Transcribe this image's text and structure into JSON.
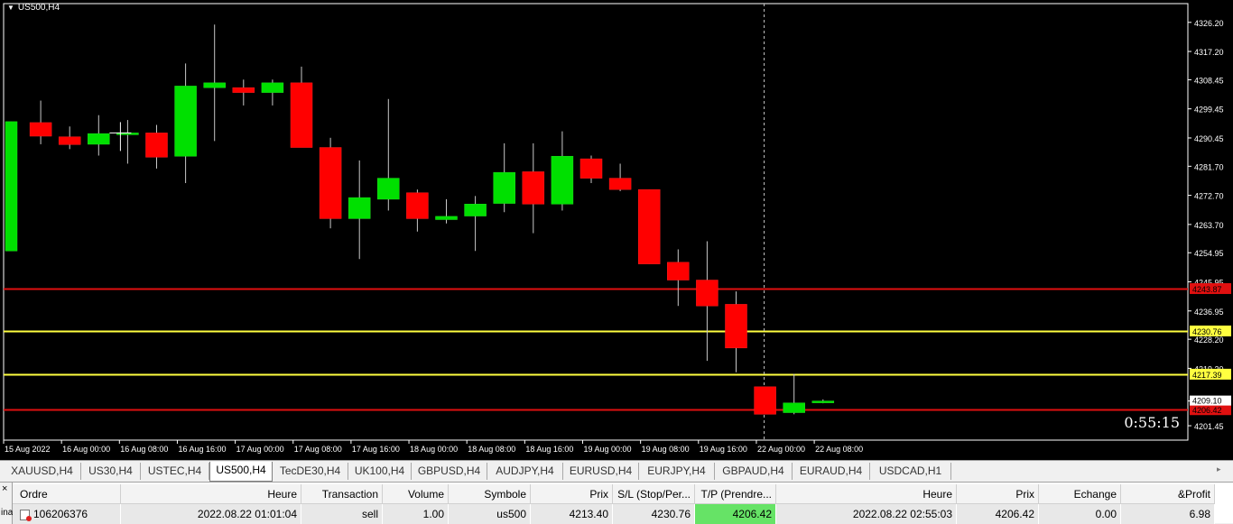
{
  "chart": {
    "symbol": "US500,H4",
    "countdown": "0:55:15",
    "colors": {
      "bull": "#00e000",
      "bear": "#ff0000",
      "wick": "#c8c8c8",
      "bg": "#000000",
      "axis": "#ffffff",
      "red_line": "#e01010",
      "yellow_line": "#ffff40"
    },
    "y_range": [
      4197.0,
      4332.0
    ],
    "price_ticks": [
      "4326.20",
      "4317.20",
      "4308.45",
      "4299.45",
      "4290.45",
      "4281.70",
      "4272.70",
      "4263.70",
      "4254.95",
      "4245.95",
      "4236.95",
      "4228.20",
      "4219.20",
      "4209.10",
      "4201.45"
    ],
    "time_labels": [
      "15 Aug 2022",
      "16 Aug 00:00",
      "16 Aug 08:00",
      "16 Aug 16:00",
      "17 Aug 00:00",
      "17 Aug 08:00",
      "17 Aug 16:00",
      "18 Aug 00:00",
      "18 Aug 08:00",
      "18 Aug 16:00",
      "19 Aug 00:00",
      "19 Aug 08:00",
      "19 Aug 16:00",
      "22 Aug 00:00",
      "22 Aug 08:00"
    ],
    "levels": [
      {
        "name": "level-red-upper",
        "price": 4243.87,
        "label": "4243.87",
        "kind": "red"
      },
      {
        "name": "level-sl",
        "price": 4230.76,
        "label": "4230.76",
        "kind": "yellow"
      },
      {
        "name": "level-yellow-lower",
        "price": 4217.39,
        "label": "4217.39",
        "kind": "yellow"
      },
      {
        "name": "level-tp",
        "price": 4206.42,
        "label": "4206.42",
        "kind": "red"
      }
    ],
    "current_price": "4209.10",
    "crosshair_index": 26
  },
  "chart_data": {
    "type": "candlestick",
    "title": "US500,H4",
    "candles": [
      {
        "o": 4255.5,
        "h": 4295.5,
        "l": 4255.5,
        "c": 4295.5
      },
      {
        "o": 4295.2,
        "h": 4302.0,
        "l": 4288.5,
        "c": 4291.0
      },
      {
        "o": 4290.8,
        "h": 4294.0,
        "l": 4287.0,
        "c": 4288.4
      },
      {
        "o": 4288.5,
        "h": 4297.5,
        "l": 4285.0,
        "c": 4291.8
      },
      {
        "o": 4292.0,
        "h": 4296.0,
        "l": 4282.5,
        "c": 4292.0
      },
      {
        "o": 4292.0,
        "h": 4294.5,
        "l": 4281.0,
        "c": 4284.5
      },
      {
        "o": 4284.8,
        "h": 4313.5,
        "l": 4276.5,
        "c": 4306.5
      },
      {
        "o": 4306.0,
        "h": 4325.5,
        "l": 4289.5,
        "c": 4307.5
      },
      {
        "o": 4306.0,
        "h": 4308.5,
        "l": 4300.5,
        "c": 4304.5
      },
      {
        "o": 4304.5,
        "h": 4308.5,
        "l": 4300.5,
        "c": 4307.5
      },
      {
        "o": 4307.5,
        "h": 4312.5,
        "l": 4287.5,
        "c": 4287.5
      },
      {
        "o": 4287.5,
        "h": 4290.5,
        "l": 4262.5,
        "c": 4265.5
      },
      {
        "o": 4265.5,
        "h": 4283.5,
        "l": 4253.0,
        "c": 4272.0
      },
      {
        "o": 4271.5,
        "h": 4302.5,
        "l": 4268.0,
        "c": 4278.0
      },
      {
        "o": 4273.5,
        "h": 4274.5,
        "l": 4261.5,
        "c": 4265.5
      },
      {
        "o": 4265.2,
        "h": 4271.5,
        "l": 4264.0,
        "c": 4266.2
      },
      {
        "o": 4266.3,
        "h": 4272.5,
        "l": 4255.5,
        "c": 4270.0
      },
      {
        "o": 4270.2,
        "h": 4288.8,
        "l": 4267.5,
        "c": 4279.8
      },
      {
        "o": 4280.0,
        "h": 4288.8,
        "l": 4261.0,
        "c": 4270.0
      },
      {
        "o": 4270.0,
        "h": 4292.5,
        "l": 4268.0,
        "c": 4284.8
      },
      {
        "o": 4284.0,
        "h": 4285.0,
        "l": 4276.5,
        "c": 4278.0
      },
      {
        "o": 4278.0,
        "h": 4282.5,
        "l": 4274.0,
        "c": 4274.5
      },
      {
        "o": 4274.5,
        "h": 4274.5,
        "l": 4251.5,
        "c": 4251.5
      },
      {
        "o": 4252.0,
        "h": 4256.0,
        "l": 4238.5,
        "c": 4246.5
      },
      {
        "o": 4246.5,
        "h": 4258.5,
        "l": 4221.5,
        "c": 4238.5
      },
      {
        "o": 4239.0,
        "h": 4243.0,
        "l": 4218.0,
        "c": 4225.5
      },
      {
        "o": 4213.5,
        "h": 4213.5,
        "l": 4205.0,
        "c": 4205.0
      },
      {
        "o": 4205.5,
        "h": 4217.5,
        "l": 4205.0,
        "c": 4208.5
      },
      {
        "o": 4209.0,
        "h": 4209.6,
        "l": 4208.4,
        "c": 4209.1
      }
    ]
  },
  "tabs": [
    {
      "label": "XAUUSD,H4",
      "active": false
    },
    {
      "label": "US30,H4",
      "active": false
    },
    {
      "label": "USTEC,H4",
      "active": false
    },
    {
      "label": "US500,H4",
      "active": true
    },
    {
      "label": "TecDE30,H4",
      "active": false
    },
    {
      "label": "UK100,H4",
      "active": false
    },
    {
      "label": "GBPUSD,H4",
      "active": false
    },
    {
      "label": "AUDJPY,H4",
      "active": false
    },
    {
      "label": "EURUSD,H4",
      "active": false
    },
    {
      "label": "EURJPY,H4",
      "active": false
    },
    {
      "label": "GBPAUD,H4",
      "active": false
    },
    {
      "label": "EURAUD,H4",
      "active": false
    },
    {
      "label": "USDCAD,H1",
      "active": false
    }
  ],
  "terminal": {
    "close_label": "×",
    "side_label": "inal",
    "headers": [
      "Ordre",
      "Heure",
      "Transaction",
      "Volume",
      "Symbole",
      "Prix",
      "S/L (Stop/Per...",
      "T/P (Prendre...",
      "Heure",
      "Prix",
      "Echange",
      "&Profit"
    ],
    "row": [
      "106206376",
      "2022.08.22 01:01:04",
      "sell",
      "1.00",
      "us500",
      "4213.40",
      "4230.76",
      "4206.42",
      "2022.08.22 02:55:03",
      "4206.42",
      "0.00",
      "6.98"
    ]
  }
}
